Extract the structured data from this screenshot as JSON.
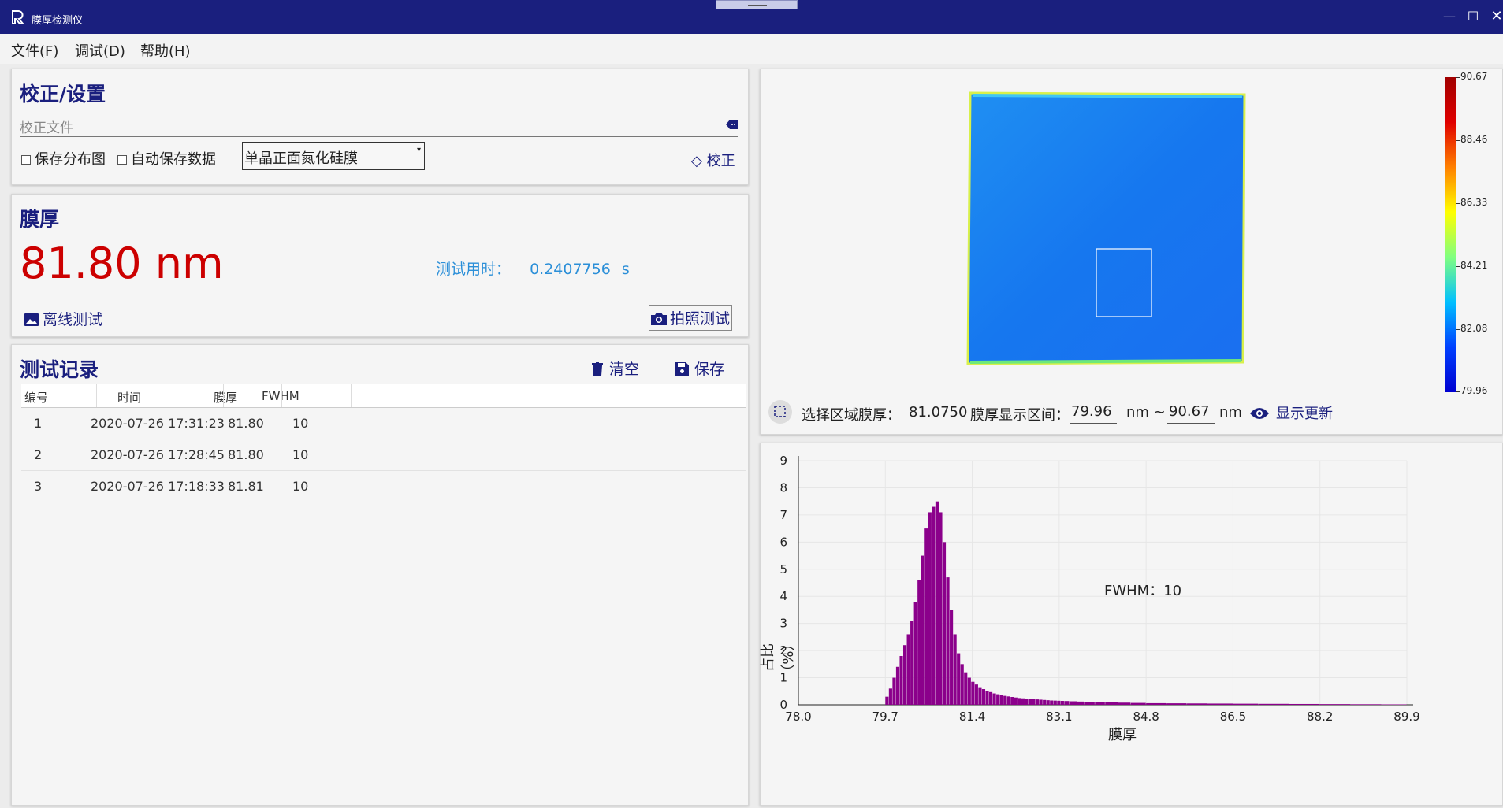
{
  "app": {
    "title": "膜厚检测仪"
  },
  "menu": {
    "file": "文件(F)",
    "debug": "调试(D)",
    "help": "帮助(H)"
  },
  "calibration": {
    "title": "校正/设置",
    "file_placeholder": "校正文件",
    "save_map": "保存分布图",
    "auto_save": "自动保存数据",
    "film_type": "单晶正面氮化硅膜",
    "calibrate": "校正"
  },
  "thickness": {
    "title": "膜厚",
    "value": "81.80 nm",
    "time_label": "测试用时：",
    "time_value": "0.2407756",
    "time_unit": "s",
    "offline": "离线测试",
    "photo": "拍照测试"
  },
  "records": {
    "title": "测试记录",
    "clear": "清空",
    "save": "保存",
    "headers": [
      "编号",
      "时间",
      "膜厚",
      "FWHM"
    ],
    "rows": [
      {
        "id": "1",
        "time": "2020-07-26 17:31:23",
        "thickness": "81.80",
        "fwhm": "10"
      },
      {
        "id": "2",
        "time": "2020-07-26 17:28:45",
        "thickness": "81.80",
        "fwhm": "10"
      },
      {
        "id": "3",
        "time": "2020-07-26 17:18:33",
        "thickness": "81.81",
        "fwhm": "10"
      }
    ]
  },
  "map": {
    "colorbar_ticks": [
      "90.67",
      "88.46",
      "86.33",
      "84.21",
      "82.08",
      "79.96"
    ],
    "region_label": "选择区域膜厚：",
    "region_value": "81.0750",
    "range_label": "膜厚显示区间：",
    "range_min": "79.96",
    "range_sep": "nm ~",
    "range_max": "90.67",
    "range_unit": "nm",
    "update": "显示更新"
  },
  "colors": {
    "title_bar": "#1a1f7e",
    "accent": "#1a1f7e",
    "thickness_red": "#cc0000",
    "time_blue": "#2b8fd8",
    "histogram": "#8b008b"
  },
  "chart_data": {
    "type": "bar",
    "xlabel": "膜厚",
    "ylabel": "占比（%）",
    "annotation": "FWHM：10",
    "xlim": [
      78.0,
      89.9
    ],
    "ylim": [
      0,
      9
    ],
    "x_ticks": [
      "78.0",
      "79.7",
      "81.4",
      "83.1",
      "84.8",
      "86.5",
      "88.2",
      "89.9"
    ],
    "y_ticks": [
      "0",
      "1",
      "2",
      "3",
      "4",
      "5",
      "6",
      "7",
      "8",
      "9"
    ],
    "series": [
      {
        "x": [
          79.7,
          79.77,
          79.84,
          79.91,
          79.98,
          80.05,
          80.12,
          80.19,
          80.26,
          80.33,
          80.4,
          80.47,
          80.54,
          80.61,
          80.68,
          80.75,
          80.82,
          80.89,
          80.96,
          81.03,
          81.1,
          81.17,
          81.24,
          81.31,
          81.38,
          81.45,
          81.52,
          81.59,
          81.66,
          81.73,
          81.8,
          81.87,
          81.94,
          82.01,
          82.08,
          82.15,
          82.22,
          82.29,
          82.36,
          82.43,
          82.5,
          82.57,
          82.64,
          82.71,
          82.78,
          82.85,
          82.92,
          82.99,
          83.06,
          83.13,
          83.2,
          83.3,
          83.45,
          83.6,
          83.8,
          84.0,
          84.25,
          84.5,
          84.8,
          85.2,
          85.6,
          86.0,
          86.5,
          87.0,
          87.6,
          88.2,
          88.8,
          89.4
        ],
        "values": [
          0.3,
          0.6,
          1.0,
          1.4,
          1.8,
          2.2,
          2.6,
          3.1,
          3.8,
          4.6,
          5.5,
          6.5,
          7.1,
          7.3,
          7.5,
          7.1,
          6.0,
          4.7,
          3.5,
          2.6,
          1.9,
          1.5,
          1.2,
          1.0,
          0.85,
          0.75,
          0.65,
          0.58,
          0.52,
          0.47,
          0.42,
          0.39,
          0.36,
          0.33,
          0.31,
          0.29,
          0.27,
          0.25,
          0.24,
          0.23,
          0.22,
          0.21,
          0.2,
          0.19,
          0.18,
          0.17,
          0.16,
          0.155,
          0.15,
          0.145,
          0.14,
          0.13,
          0.12,
          0.11,
          0.1,
          0.09,
          0.08,
          0.07,
          0.06,
          0.055,
          0.05,
          0.045,
          0.04,
          0.035,
          0.03,
          0.025,
          0.02,
          0.015
        ]
      }
    ]
  }
}
